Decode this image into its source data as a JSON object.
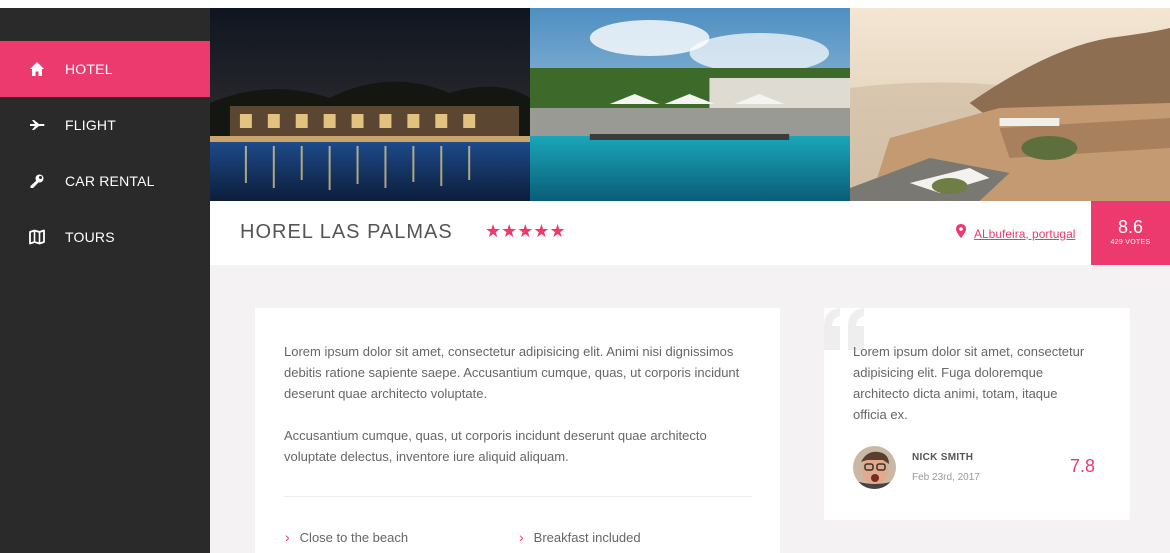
{
  "nav": {
    "items": [
      {
        "label": "HOTEL",
        "icon": "home-icon",
        "active": true
      },
      {
        "label": "FLIGHT",
        "icon": "plane-icon",
        "active": false
      },
      {
        "label": "CAR RENTAL",
        "icon": "wrench-icon",
        "active": false
      },
      {
        "label": "TOURS",
        "icon": "map-icon",
        "active": false
      }
    ]
  },
  "hotel": {
    "name": "HOREL LAS PALMAS",
    "stars": "★★★★★",
    "rating_stars": 5,
    "location": "ALbufeira, portugal",
    "score": "8.6",
    "votes": "429 VOTES"
  },
  "description": {
    "paragraph1": "Lorem ipsum dolor sit amet, consectetur adipisicing elit. Animi nisi dignissimos debitis ratione sapiente saepe. Accusantium cumque, quas, ut corporis incidunt deserunt quae architecto voluptate.",
    "paragraph2": "Accusantium cumque, quas, ut corporis incidunt deserunt quae architecto voluptate delectus, inventore iure aliquid aliquam.",
    "features": [
      "Close to the beach",
      "Breakfast included"
    ]
  },
  "review": {
    "text": "Lorem ipsum dolor sit amet, consectetur adipisicing elit. Fuga doloremque architecto dicta animi, totam, itaque officia ex.",
    "reviewer": "NICK SMITH",
    "date": "Feb 23rd, 2017",
    "score": "7.8"
  },
  "colors": {
    "accent": "#ec3a6e",
    "sidebar": "#2a2a2a",
    "background": "#f4f2f2"
  }
}
